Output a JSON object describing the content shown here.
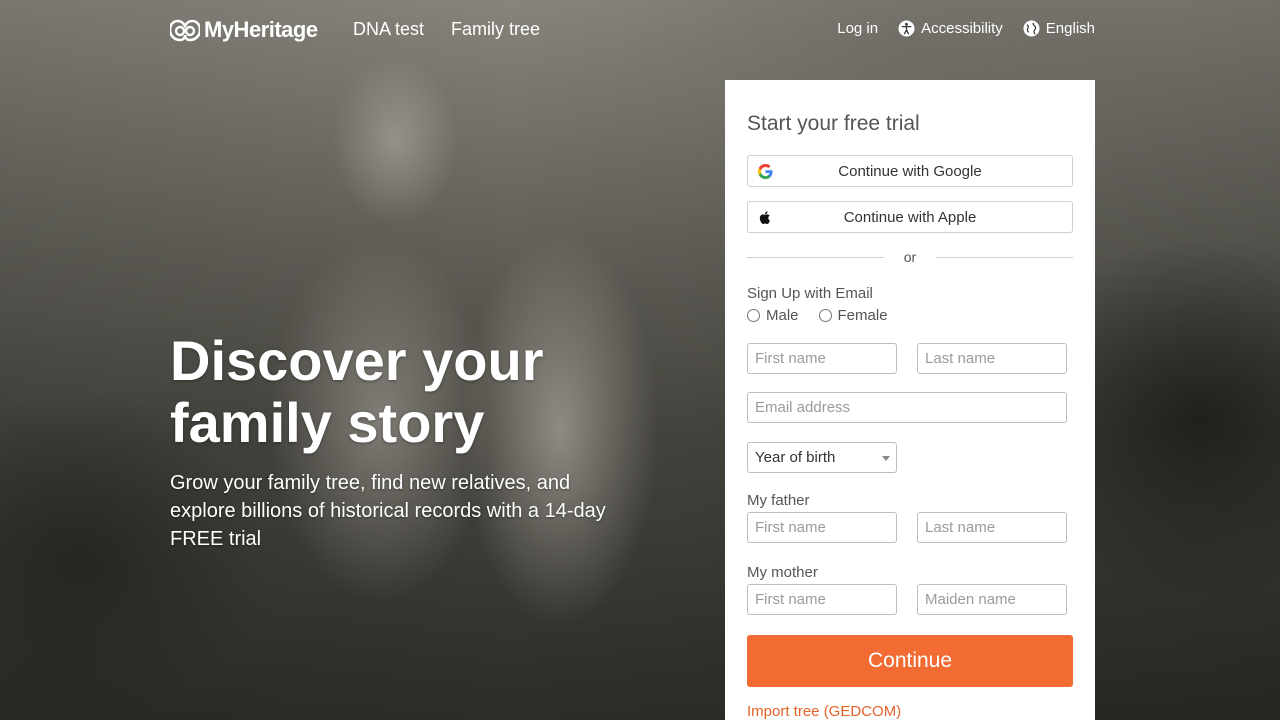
{
  "header": {
    "logo_text": "MyHeritage",
    "nav": [
      "DNA test",
      "Family tree"
    ],
    "login": "Log in",
    "accessibility": "Accessibility",
    "language": "English"
  },
  "hero": {
    "headline_line1": "Discover your",
    "headline_line2": "family story",
    "subtext": "Grow your family tree, find new relatives, and explore billions of historical records with a 14-day FREE trial"
  },
  "signup": {
    "title": "Start your free trial",
    "google_label": "Continue with Google",
    "apple_label": "Continue with Apple",
    "or_label": "or",
    "email_section_label": "Sign Up with Email",
    "gender_male": "Male",
    "gender_female": "Female",
    "first_name_placeholder": "First name",
    "last_name_placeholder": "Last name",
    "email_placeholder": "Email address",
    "year_of_birth": "Year of birth",
    "father_label": "My father",
    "father_first_placeholder": "First name",
    "father_last_placeholder": "Last name",
    "mother_label": "My mother",
    "mother_first_placeholder": "First name",
    "mother_maiden_placeholder": "Maiden name",
    "continue_label": "Continue",
    "import_label": "Import tree (GEDCOM)"
  },
  "colors": {
    "accent": "#f16b33",
    "link": "#e5622a"
  }
}
